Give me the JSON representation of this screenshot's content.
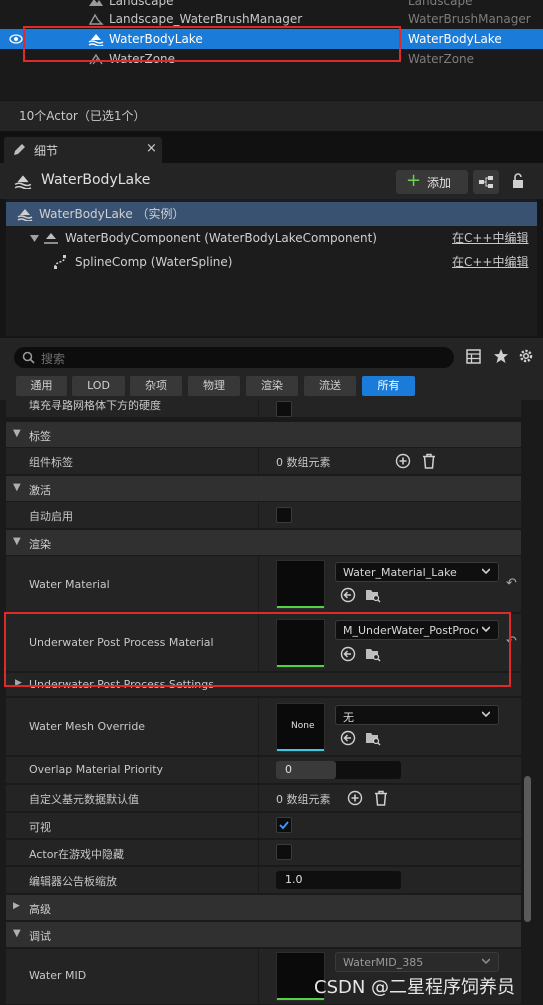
{
  "outliner": {
    "rows": [
      {
        "name": "Landscape",
        "type": "Landscape"
      },
      {
        "name": "Landscape_WaterBrushManager",
        "type": "WaterBrushManager"
      },
      {
        "name": "WaterBodyLake",
        "type": "WaterBodyLake"
      },
      {
        "name": "WaterZone",
        "type": "WaterZone"
      }
    ],
    "status": "10个Actor（已选1个）"
  },
  "details": {
    "tab_label": "细节",
    "tab_close": "×",
    "actor_name": "WaterBodyLake",
    "add_label": "添加",
    "add_plus": "+",
    "components": [
      {
        "label": "WaterBodyLake （实例）"
      },
      {
        "label": "WaterBodyComponent (WaterBodyLakeComponent)",
        "edit": "在C++中编辑"
      },
      {
        "label": "SplineComp (WaterSpline)",
        "edit": "在C++中编辑"
      }
    ],
    "search_placeholder": "搜索",
    "filters": [
      "通用",
      "LOD",
      "杂项",
      "物理",
      "渲染",
      "流送",
      "所有"
    ]
  },
  "properties": {
    "partial_row": "填充寻路网格体下方的硬度",
    "cat_tags": "标签",
    "component_tags": "组件标签",
    "component_tags_value": "0 数组元素",
    "cat_activation": "激活",
    "auto_activate": "自动启用",
    "cat_rendering": "渲染",
    "water_material": "Water Material",
    "water_material_value": "Water_Material_Lake",
    "underwater_pp_material": "Underwater Post Process Material",
    "underwater_pp_material_value": "M_UnderWater_PostProce",
    "underwater_pp_settings": "Underwater Post Process Settings",
    "water_mesh_override": "Water Mesh Override",
    "water_mesh_thumb": "None",
    "water_mesh_value": "无",
    "overlap_priority": "Overlap Material Priority",
    "overlap_priority_value": "0",
    "custom_primitive": "自定义基元数据默认值",
    "custom_primitive_value": "0 数组元素",
    "visible": "可视",
    "hidden_in_game": "Actor在游戏中隐藏",
    "billboard_scale": "编辑器公告板缩放",
    "billboard_scale_value": "1.0",
    "cat_advanced": "高级",
    "cat_debug": "调试",
    "water_mid": "Water MID",
    "water_mid_value": "WaterMID_385"
  },
  "watermark": "CSDN @二星程序饲养员",
  "colors": {
    "selection": "#1a7bd8",
    "highlight_box": "#e02a2a",
    "accent_green": "#4fd244"
  }
}
